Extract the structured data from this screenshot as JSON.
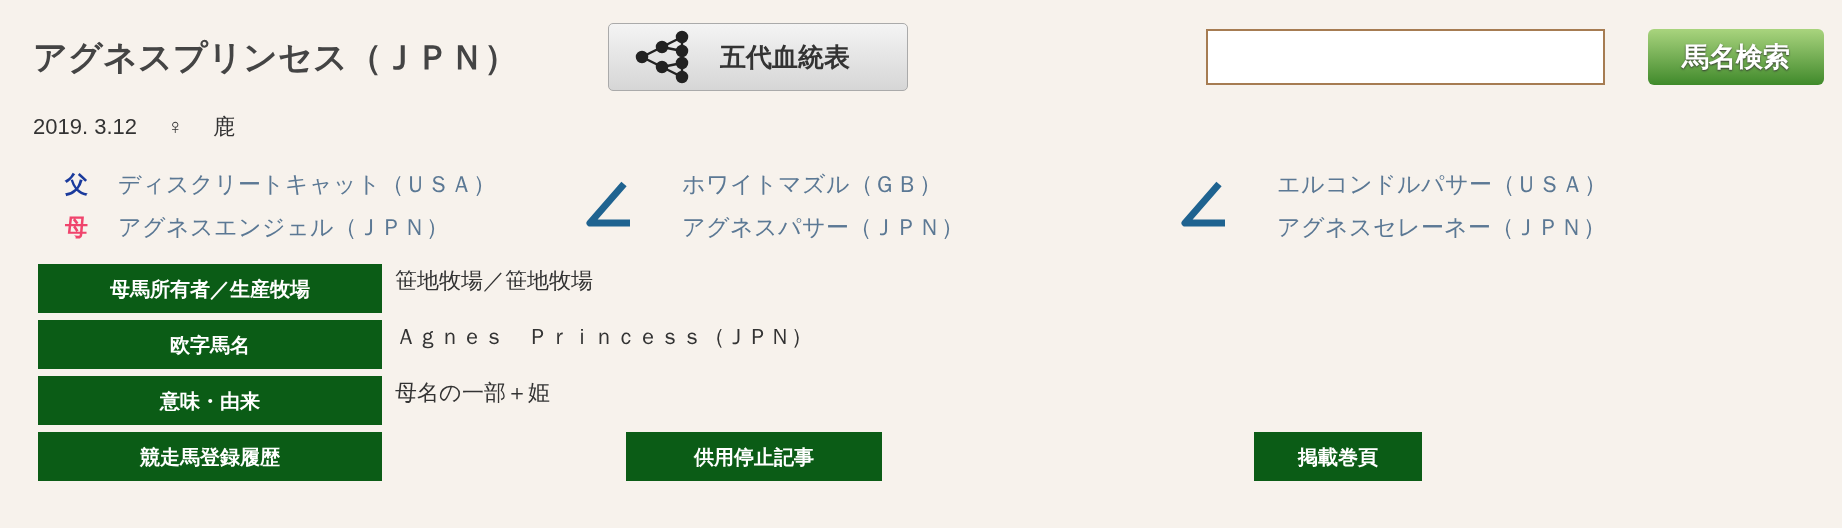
{
  "title": "アグネスプリンセス（ＪＰＮ）",
  "pedigree_button": "五代血統表",
  "search": {
    "button": "馬名検索"
  },
  "birth_date": "2019. 3.12",
  "sex": "♀",
  "coat": "鹿",
  "pedigree": [
    {
      "lines": [
        {
          "label": "父",
          "color": "#1a3a9c",
          "name": "ディスクリートキャット（ＵＳＡ）"
        },
        {
          "label": "母",
          "color": "#f0446c",
          "name": "アグネスエンジェル（ＪＰＮ）"
        }
      ]
    },
    {
      "lines": [
        {
          "name": "ホワイトマズル（ＧＢ）"
        },
        {
          "name": "アグネスパサー（ＪＰＮ）"
        }
      ]
    },
    {
      "lines": [
        {
          "name": "エルコンドルパサー（ＵＳＡ）"
        },
        {
          "name": "アグネスセレーネー（ＪＰＮ）"
        }
      ]
    }
  ],
  "rows": [
    {
      "kind": "text",
      "label": "母馬所有者／生産牧場",
      "value": "笹地牧場／笹地牧場"
    },
    {
      "kind": "text",
      "label": "欧字馬名",
      "value": "Ａｇｎｅｓ　Ｐｒｉｎｃｅｓｓ（ＪＰＮ）"
    },
    {
      "kind": "text",
      "label": "意味・由来",
      "value": "母名の一部＋姫"
    },
    {
      "kind": "buttons",
      "label": "競走馬登録履歴",
      "buttons": [
        "供用停止記事",
        "掲載巻頁"
      ]
    }
  ]
}
